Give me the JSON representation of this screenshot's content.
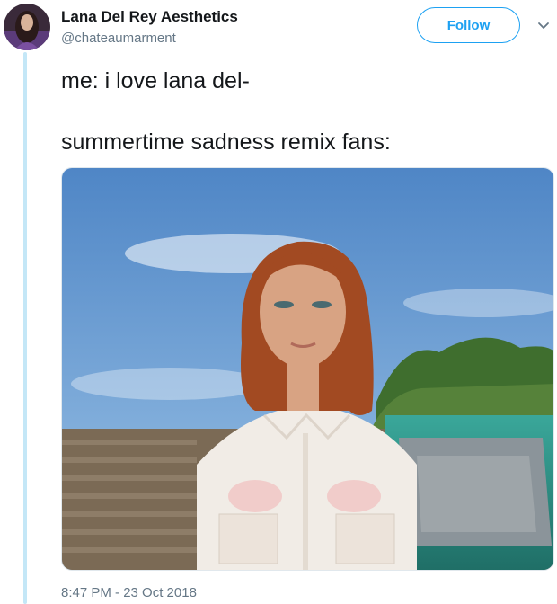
{
  "tweet": {
    "author_name": "Lana Del Rey Aesthetics",
    "author_handle": "@chateaumarment",
    "follow_label": "Follow",
    "text_line_1": "me: i love lana del-",
    "text_line_2": "summertime sadness remix fans:",
    "timestamp": "8:47 PM - 23 Oct 2018"
  },
  "icons": {
    "more": "chevron-down-icon"
  },
  "colors": {
    "accent": "#1da1f2",
    "secondary_text": "#657786",
    "thread_line": "#c4e7f7"
  }
}
